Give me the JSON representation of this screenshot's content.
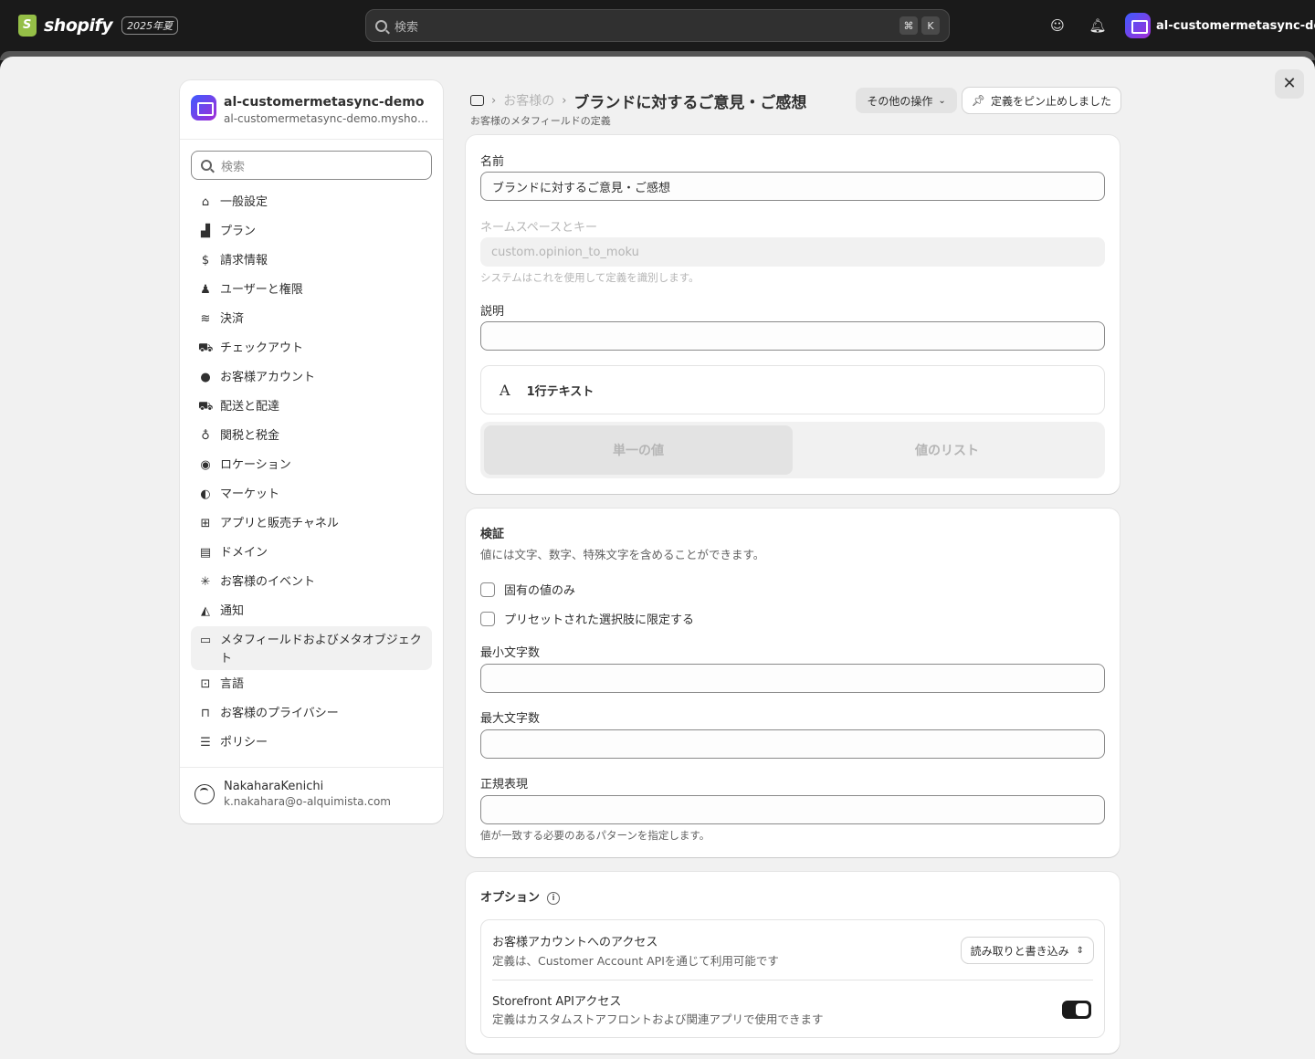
{
  "topbar": {
    "logo_text": "shopify",
    "edition": "2025年夏",
    "search_placeholder": "検索",
    "shortcut_cmd": "⌘",
    "shortcut_key": "K",
    "store_name": "al-customermetasync-de..."
  },
  "sidebar": {
    "store_title": "al-customermetasync-demo",
    "store_url": "al-customermetasync-demo.myshopify.com",
    "search_placeholder": "検索",
    "items": [
      {
        "label": "一般設定",
        "icon": "store-icon",
        "glyph": "⌂"
      },
      {
        "label": "プラン",
        "icon": "plan-icon",
        "glyph": "▟"
      },
      {
        "label": "請求情報",
        "icon": "billing-icon",
        "glyph": "$"
      },
      {
        "label": "ユーザーと権限",
        "icon": "users-icon",
        "glyph": "♟"
      },
      {
        "label": "決済",
        "icon": "payments-icon",
        "glyph": "≋"
      },
      {
        "label": "チェックアウト",
        "icon": "cart-icon",
        "glyph": "⛟"
      },
      {
        "label": "お客様アカウント",
        "icon": "person-icon",
        "glyph": "●"
      },
      {
        "label": "配送と配達",
        "icon": "truck-icon",
        "glyph": "⛟"
      },
      {
        "label": "関税と税金",
        "icon": "tax-icon",
        "glyph": "♁"
      },
      {
        "label": "ロケーション",
        "icon": "location-icon",
        "glyph": "◉"
      },
      {
        "label": "マーケット",
        "icon": "globe-icon",
        "glyph": "◐"
      },
      {
        "label": "アプリと販売チャネル",
        "icon": "apps-icon",
        "glyph": "⊞"
      },
      {
        "label": "ドメイン",
        "icon": "domain-icon",
        "glyph": "▤"
      },
      {
        "label": "お客様のイベント",
        "icon": "cursor-icon",
        "glyph": "✳"
      },
      {
        "label": "通知",
        "icon": "bell-icon",
        "glyph": "◭"
      },
      {
        "label": "メタフィールドおよびメタオブジェクト",
        "icon": "metafield-icon",
        "glyph": "▭",
        "active": true
      },
      {
        "label": "言語",
        "icon": "language-icon",
        "glyph": "⊡"
      },
      {
        "label": "お客様のプライバシー",
        "icon": "lock-icon",
        "glyph": "⊓"
      },
      {
        "label": "ポリシー",
        "icon": "policy-icon",
        "glyph": "☰"
      }
    ],
    "user_name": "NakaharaKenichi",
    "user_email": "k.nakahara@o-alquimista.com"
  },
  "header": {
    "breadcrumb_prev": "お客様の",
    "title": "ブランドに対するご意見・ご感想",
    "subtitle": "お客様のメタフィールドの定義",
    "more_actions": "その他の操作",
    "pinned": "定義をピン止めしました"
  },
  "definition": {
    "name_label": "名前",
    "name_value": "ブランドに対するご意見・ご感想",
    "namespace_label": "ネームスペースとキー",
    "namespace_value": "custom.opinion_to_moku",
    "namespace_help": "システムはこれを使用して定義を識別します。",
    "description_label": "説明",
    "description_value": "",
    "type_label": "1行テキスト",
    "type_glyph": "A",
    "single_value": "単一の値",
    "list_value": "値のリスト"
  },
  "validation": {
    "title": "検証",
    "subtitle": "値には文字、数字、特殊文字を含めることができます。",
    "unique_only": "固有の値のみ",
    "preset_choices": "プリセットされた選択肢に限定する",
    "min_label": "最小文字数",
    "max_label": "最大文字数",
    "regex_label": "正規表現",
    "regex_help": "値が一致する必要のあるパターンを指定します。"
  },
  "options": {
    "title": "オプション",
    "customer_access_title": "お客様アカウントへのアクセス",
    "customer_access_desc": "定義は、Customer Account APIを通じて利用可能です",
    "customer_access_value": "読み取りと書き込み",
    "storefront_title": "Storefront APIアクセス",
    "storefront_desc": "定義はカスタムストアフロントおよび関連アプリで使用できます",
    "storefront_enabled": true
  }
}
